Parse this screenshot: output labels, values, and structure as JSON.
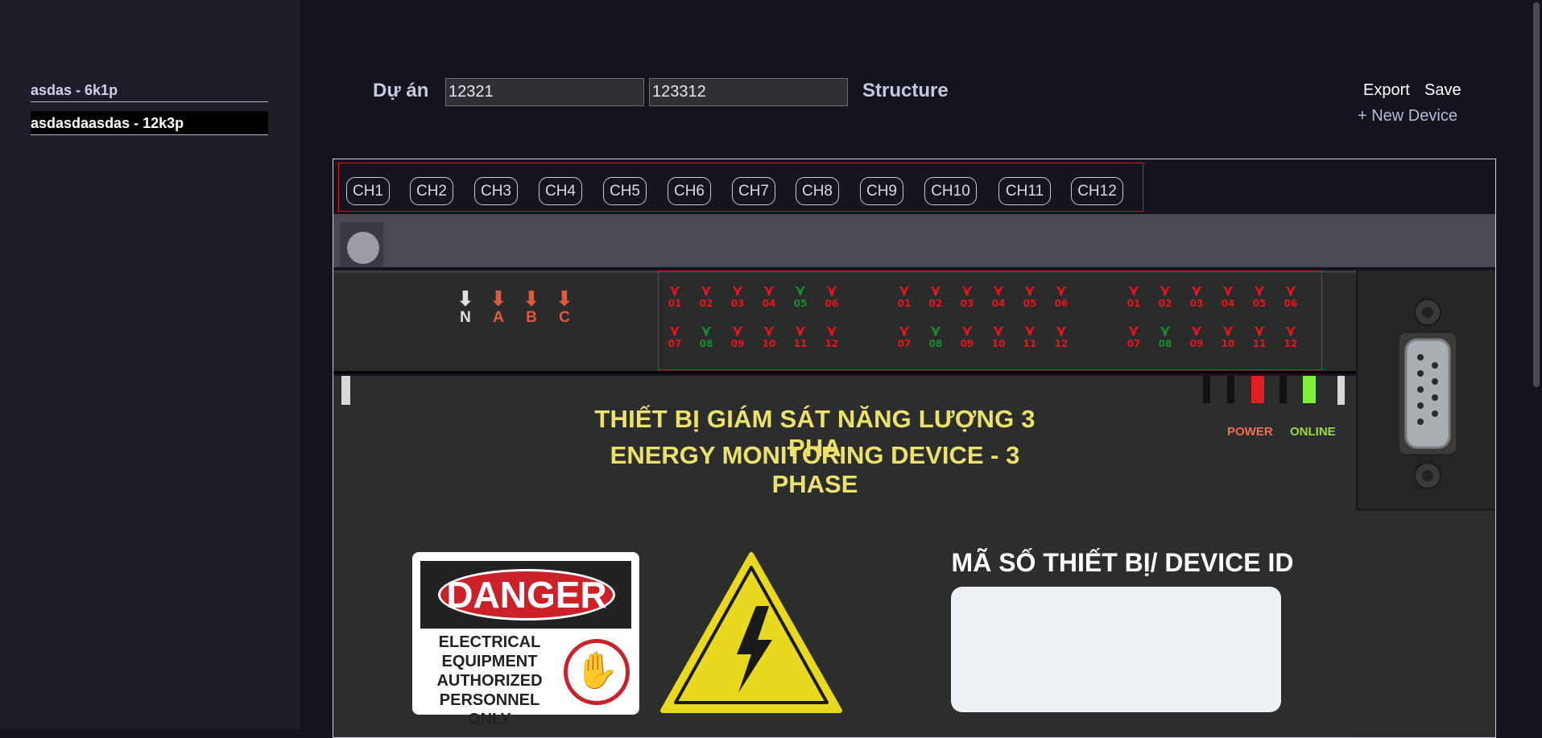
{
  "sidebar": {
    "projects": [
      {
        "label": "asdas - 6k1p"
      },
      {
        "label": "asdasdaasdas - 12k3p"
      }
    ]
  },
  "header": {
    "project_label": "Dự án",
    "input1_value": "12321",
    "input2_value": "123312",
    "structure_label": "Structure",
    "export_label": "Export",
    "save_label": "Save",
    "new_device_label": "+ New Device"
  },
  "channels": [
    "CH1",
    "CH2",
    "CH3",
    "CH4",
    "CH5",
    "CH6",
    "CH7",
    "CH8",
    "CH9",
    "CH10",
    "CH11",
    "CH12"
  ],
  "device": {
    "arrows": [
      {
        "label": "N",
        "color": "#e0e0e0"
      },
      {
        "label": "A",
        "color": "#e25a3c"
      },
      {
        "label": "B",
        "color": "#e25a3c"
      },
      {
        "label": "C",
        "color": "#e25a3c"
      }
    ],
    "terminal_groups": [
      {
        "row1": [
          "01",
          "02",
          "03",
          "04",
          "05",
          "06"
        ],
        "row2": [
          "07",
          "08",
          "09",
          "10",
          "11",
          "12"
        ],
        "green": [
          "05",
          "08"
        ]
      },
      {
        "row1": [
          "01",
          "02",
          "03",
          "04",
          "05",
          "06"
        ],
        "row2": [
          "07",
          "08",
          "09",
          "10",
          "11",
          "12"
        ],
        "green": [
          "08"
        ]
      },
      {
        "row1": [
          "01",
          "02",
          "03",
          "04",
          "05",
          "06"
        ],
        "row2": [
          "07",
          "08",
          "09",
          "10",
          "11",
          "12"
        ],
        "green": [
          "08"
        ]
      }
    ],
    "colors": {
      "terminal_red": "#e8141c",
      "terminal_green": "#1a8a2a",
      "title_yellow": "#ece26a"
    },
    "title_line1": "THIẾT BỊ GIÁM SÁT NĂNG LƯỢNG 3 PHA",
    "title_line2": "ENERGY MONITORING DEVICE - 3 PHASE",
    "power_label": "POWER",
    "online_label": "ONLINE",
    "danger_label": "DANGER",
    "danger_text": "ELECTRICAL EQUIPMENT AUTHORIZED PERSONNEL ONLY",
    "device_id_label": "MÃ SỐ THIẾT BỊ/ DEVICE ID"
  }
}
